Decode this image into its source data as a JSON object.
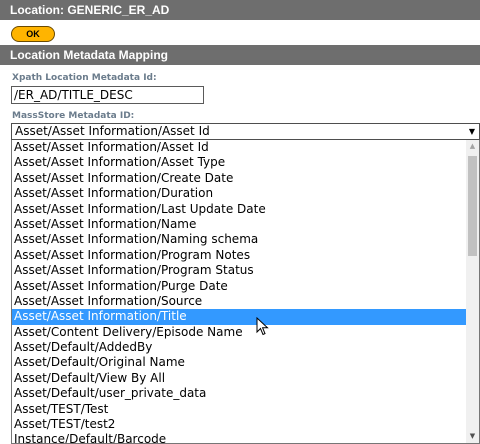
{
  "location_title": "Location: GENERIC_ER_AD",
  "ok_label": "OK",
  "section_title": "Location Metadata Mapping",
  "xpath": {
    "label": "Xpath Location Metadata Id:",
    "value": "/ER_AD/TITLE_DESC"
  },
  "massstore": {
    "label": "MassStore Metadata ID:",
    "selected": "Asset/Asset Information/Asset Id",
    "selected_index": 13,
    "options": [
      "Asset/Asset Information/Asset Id",
      "Asset/Asset Information/Asset Type",
      "Asset/Asset Information/Create Date",
      "Asset/Asset Information/Duration",
      "Asset/Asset Information/Last Update Date",
      "Asset/Asset Information/Name",
      "Asset/Asset Information/Naming schema",
      "Asset/Asset Information/Program Notes",
      "Asset/Asset Information/Program Status",
      "Asset/Asset Information/Purge Date",
      "Asset/Asset Information/Source",
      "Asset/Asset Information/Title",
      "Asset/Content Delivery/Episode Name",
      "Asset/Default/AddedBy",
      "Asset/Default/Original Name",
      "Asset/Default/View By All",
      "Asset/Default/user_private_data",
      "Asset/TEST/Test",
      "Asset/TEST/test2",
      "Instance/Default/Barcode"
    ]
  },
  "colors": {
    "header_bg": "#6e6e6e",
    "ok_bg": "#ffb400",
    "highlight_bg": "#3399ff",
    "label_color": "#6b7c8c"
  }
}
